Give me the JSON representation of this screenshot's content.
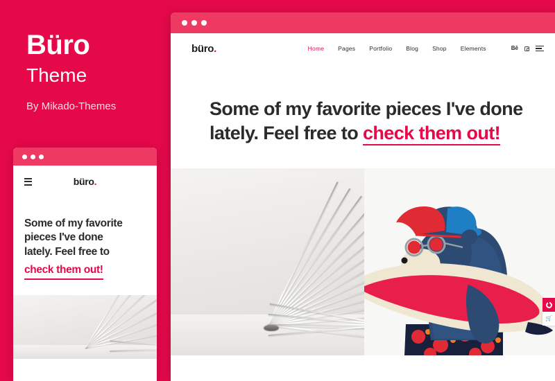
{
  "colors": {
    "brand": "#e5094a",
    "brand_light": "#ee3a63",
    "text_dark": "#2b2b2b",
    "text_muted": "#fbdde5"
  },
  "promo": {
    "title": "Büro",
    "subtitle": "Theme",
    "author": "By Mikado-Themes"
  },
  "desktop_preview": {
    "window_dots": [
      "dot-1",
      "dot-2",
      "dot-3"
    ],
    "logo": "büro",
    "logo_accent": ".",
    "nav_links": [
      {
        "label": "Home",
        "active": true
      },
      {
        "label": "Pages",
        "active": false
      },
      {
        "label": "Portfolio",
        "active": false
      },
      {
        "label": "Blog",
        "active": false
      },
      {
        "label": "Shop",
        "active": false
      },
      {
        "label": "Elements",
        "active": false
      }
    ],
    "nav_icons": [
      {
        "name": "behance-icon",
        "glyph": "Bē"
      },
      {
        "name": "instagram-icon",
        "glyph": ""
      },
      {
        "name": "hamburger-menu-icon",
        "glyph": ""
      }
    ],
    "hero": {
      "line_1": "Some of my favorite pieces I've done",
      "line_2": "lately. Feel free to ",
      "link": "check them out!"
    },
    "gallery": [
      {
        "name": "open-book-photo",
        "alt": "Open book with fanned pages"
      },
      {
        "name": "surfer-bear-illustration",
        "alt": "Illustrated bear with cap, sunglasses and surfboard"
      }
    ]
  },
  "side_widget": {
    "buttons": [
      {
        "name": "theme-options-button",
        "icon": "ring-icon"
      },
      {
        "name": "cart-button",
        "icon": "cart-icon",
        "glyph": "🛒"
      }
    ]
  },
  "mobile_preview": {
    "window_dots": [
      "dot-1",
      "dot-2",
      "dot-3"
    ],
    "menu_label": "menu",
    "logo": "büro",
    "logo_accent": ".",
    "hero": {
      "line_1": "Some of my favorite",
      "line_2": "pieces I've done",
      "line_3": "lately. Feel free to",
      "link": "check them out!"
    }
  }
}
